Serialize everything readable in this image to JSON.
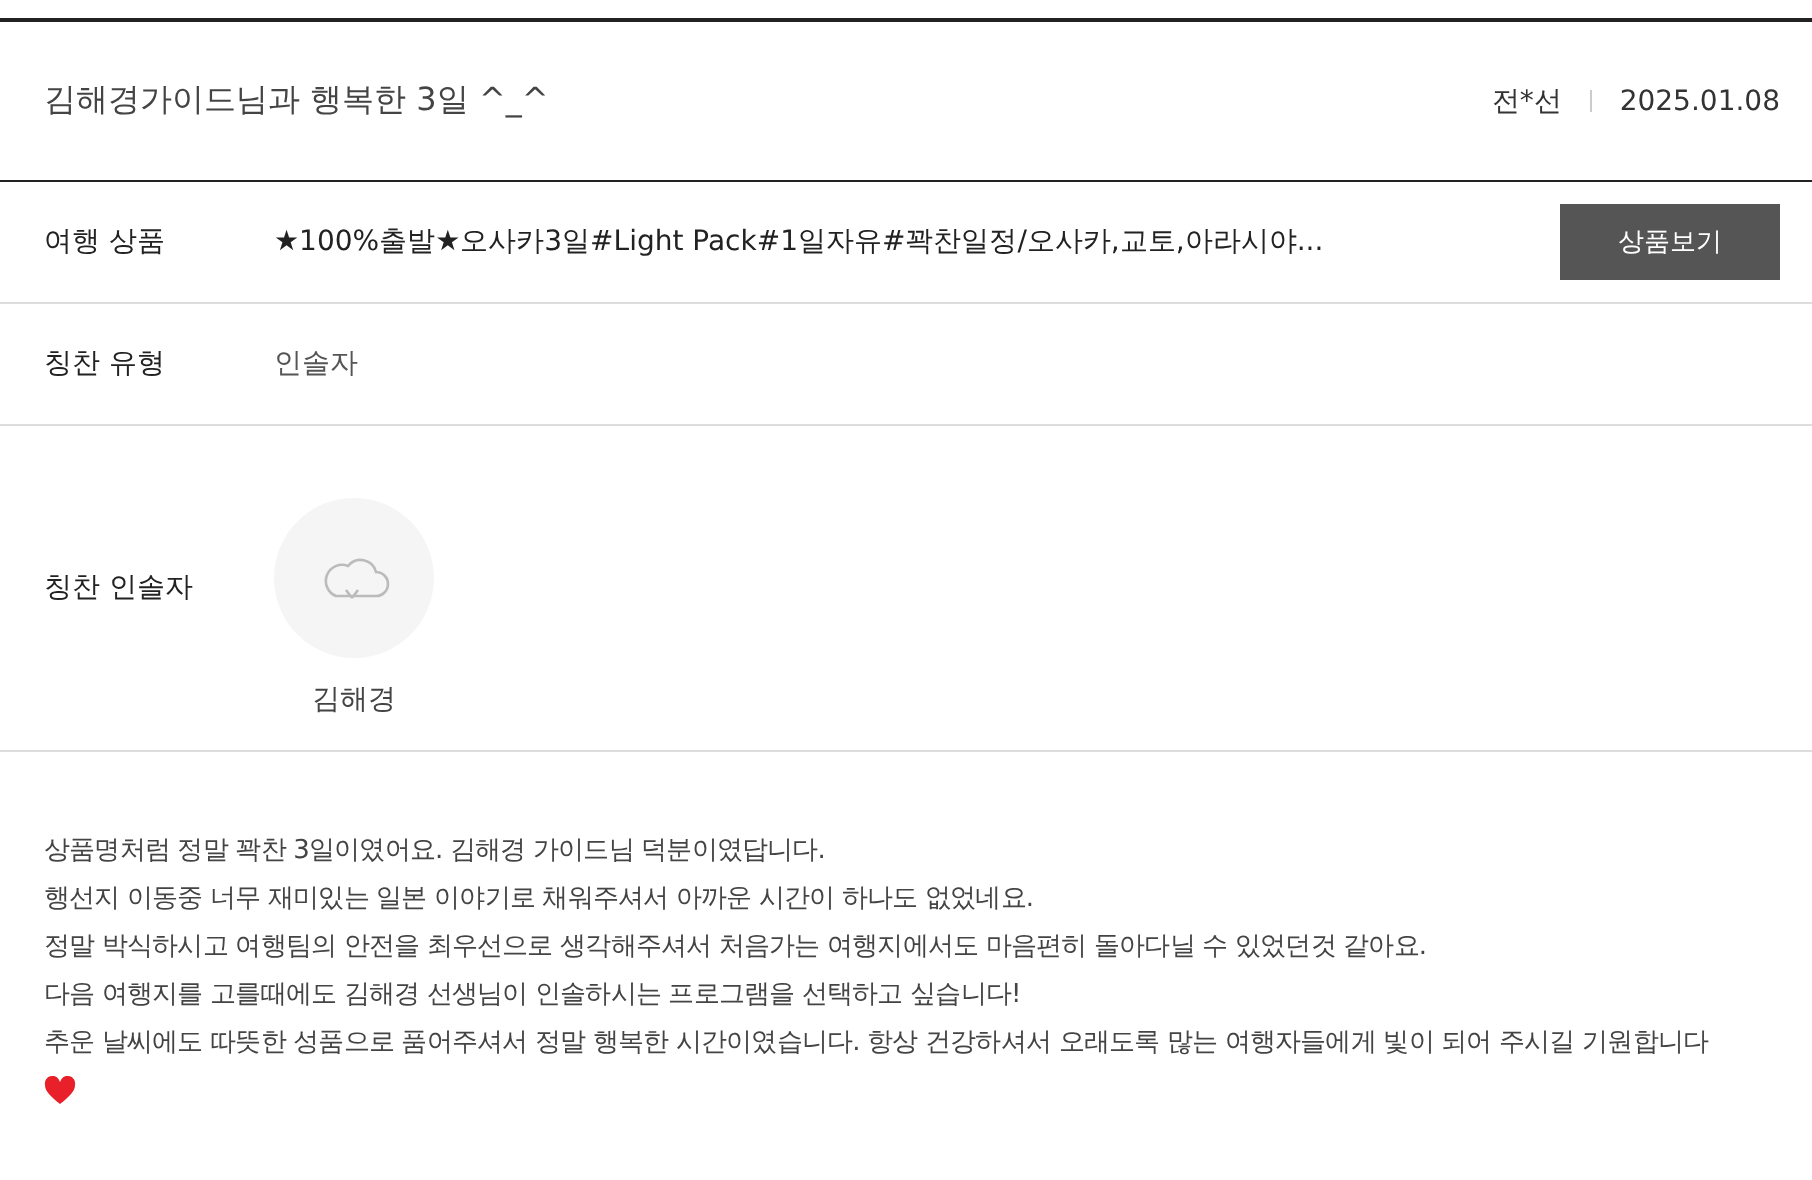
{
  "title": "김해경가이드님과 행복한 3일 ^_^",
  "author": "전*선",
  "date": "2025.01.08",
  "rows": [
    {
      "kind": "product",
      "label": "여행 상품",
      "value": "★100%출발★오사카3일#Light Pack#1일자유#꽉찬일정/오사카,교토,아라시야...",
      "button": "상품보기"
    },
    {
      "kind": "text",
      "label": "칭찬 유형",
      "value": "인솔자"
    },
    {
      "kind": "guide",
      "label": "칭찬 인솔자",
      "name": "김해경"
    }
  ],
  "review": [
    "상품명처럼 정말 꽉찬 3일이였어요. 김해경 가이드님 덕분이였답니다.",
    "행선지 이동중 너무 재미있는 일본 이야기로 채워주셔서 아까운 시간이 하나도 없었네요.",
    "정말 박식하시고 여행팀의 안전을 최우선으로 생각해주셔서 처음가는 여행지에서도 마음편히 돌아다닐 수 있었던것 같아요.",
    "다음 여행지를 고를때에도 김해경 선생님이 인솔하시는 프로그램을 선택하고 싶습니다!",
    "추운 날씨에도 따뜻한 성품으로 품어주셔서 정말 행복한 시간이였습니다. 항상 건강하셔서 오래도록 많는 여행자들에게 빛이 되어 주시길 기원합니다"
  ]
}
